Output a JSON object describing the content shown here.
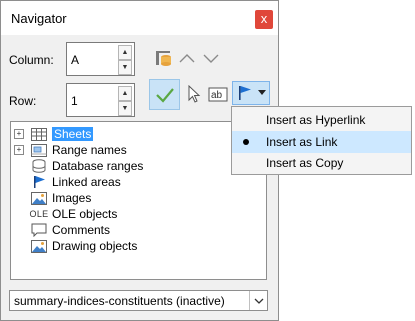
{
  "window": {
    "title": "Navigator",
    "close_glyph": "x"
  },
  "column": {
    "label": "Column:",
    "value": "A"
  },
  "row": {
    "label": "Row:",
    "value": "1"
  },
  "toolbar": {
    "icons": [
      "data-range-icon",
      "previous-icon",
      "next-icon",
      "content-toggle-icon",
      "pointer-icon",
      "ab-text-icon",
      "drag-mode-icon",
      "dropdown-arrow-icon"
    ]
  },
  "tree": {
    "items": [
      {
        "label": "Sheets",
        "icon": "sheets-icon",
        "expandable": true,
        "selected": true
      },
      {
        "label": "Range names",
        "icon": "range-names-icon",
        "expandable": true,
        "selected": false
      },
      {
        "label": "Database ranges",
        "icon": "database-icon",
        "expandable": false,
        "selected": false
      },
      {
        "label": "Linked areas",
        "icon": "linked-areas-icon",
        "expandable": false,
        "selected": false
      },
      {
        "label": "Images",
        "icon": "image-icon",
        "expandable": false,
        "selected": false
      },
      {
        "label": "OLE objects",
        "icon": "ole-icon",
        "expandable": false,
        "selected": false
      },
      {
        "label": "Comments",
        "icon": "comment-icon",
        "expandable": false,
        "selected": false
      },
      {
        "label": "Drawing objects",
        "icon": "drawing-icon",
        "expandable": false,
        "selected": false
      }
    ],
    "ole_icon_text": "OLE"
  },
  "document_select": {
    "value": "summary-indices-constituents (inactive)"
  },
  "drag_menu": {
    "items": [
      {
        "label": "Insert as Hyperlink",
        "checked": false
      },
      {
        "label": "Insert as Link",
        "checked": true
      },
      {
        "label": "Insert as Copy",
        "checked": false
      }
    ]
  },
  "colors": {
    "selection": "#3399ff",
    "close": "#e0473a",
    "toolbar_active": "#c9e3f7",
    "menu_checked": "#cde8ff"
  }
}
